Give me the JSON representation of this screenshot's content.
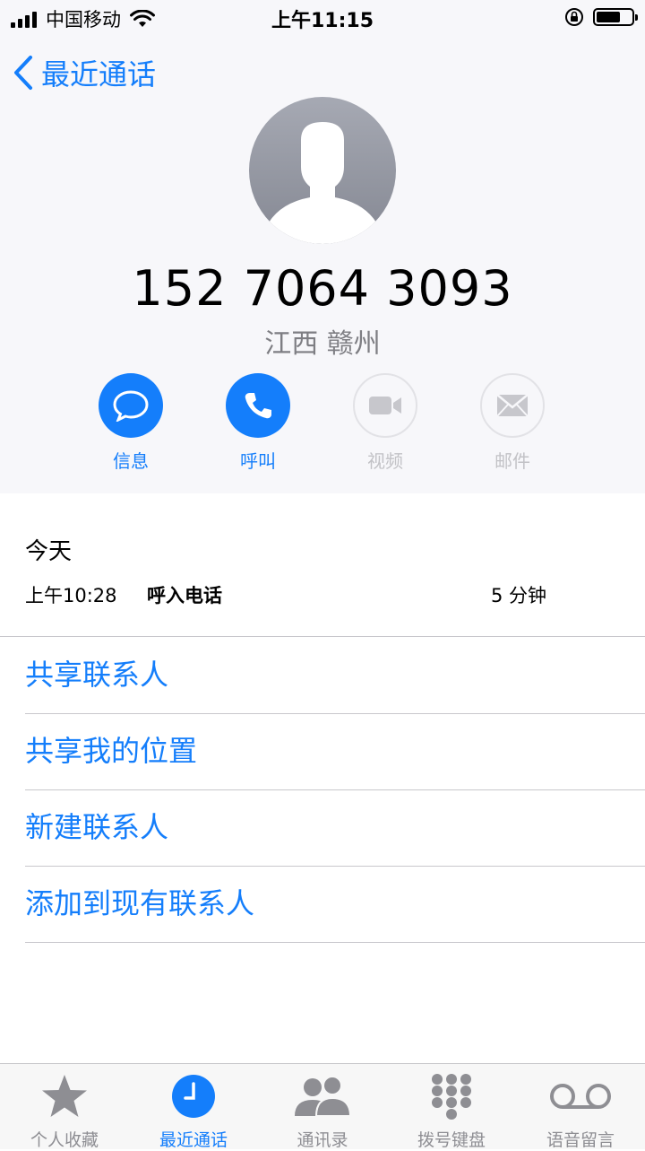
{
  "status_bar": {
    "carrier": "中国移动",
    "time": "上午11:15"
  },
  "nav": {
    "back_label": "最近通话"
  },
  "contact": {
    "phone_number": "152 7064 3093",
    "location": "江西 赣州"
  },
  "actions": [
    {
      "label": "信息",
      "icon": "message-icon",
      "enabled": true
    },
    {
      "label": "呼叫",
      "icon": "phone-icon",
      "enabled": true
    },
    {
      "label": "视频",
      "icon": "video-icon",
      "enabled": false
    },
    {
      "label": "邮件",
      "icon": "mail-icon",
      "enabled": false
    }
  ],
  "call_history": {
    "date_header": "今天",
    "entries": [
      {
        "time": "上午10:28",
        "type": "呼入电话",
        "duration": "5 分钟"
      }
    ]
  },
  "menu": [
    {
      "label": "共享联系人"
    },
    {
      "label": "共享我的位置"
    },
    {
      "label": "新建联系人"
    },
    {
      "label": "添加到现有联系人"
    }
  ],
  "tab_bar": {
    "tabs": [
      {
        "label": "个人收藏",
        "icon": "star-icon",
        "active": false
      },
      {
        "label": "最近通话",
        "icon": "clock-icon",
        "active": true
      },
      {
        "label": "通讯录",
        "icon": "contacts-icon",
        "active": false
      },
      {
        "label": "拨号键盘",
        "icon": "keypad-icon",
        "active": false
      },
      {
        "label": "语音留言",
        "icon": "voicemail-icon",
        "active": false
      }
    ]
  },
  "colors": {
    "accent": "#147efb",
    "header_bg": "#f7f7fa",
    "disabled": "#c2c2c6",
    "secondary_text": "#7e7e83",
    "separator": "#c8c7cc",
    "tab_inactive": "#8e8e93"
  }
}
